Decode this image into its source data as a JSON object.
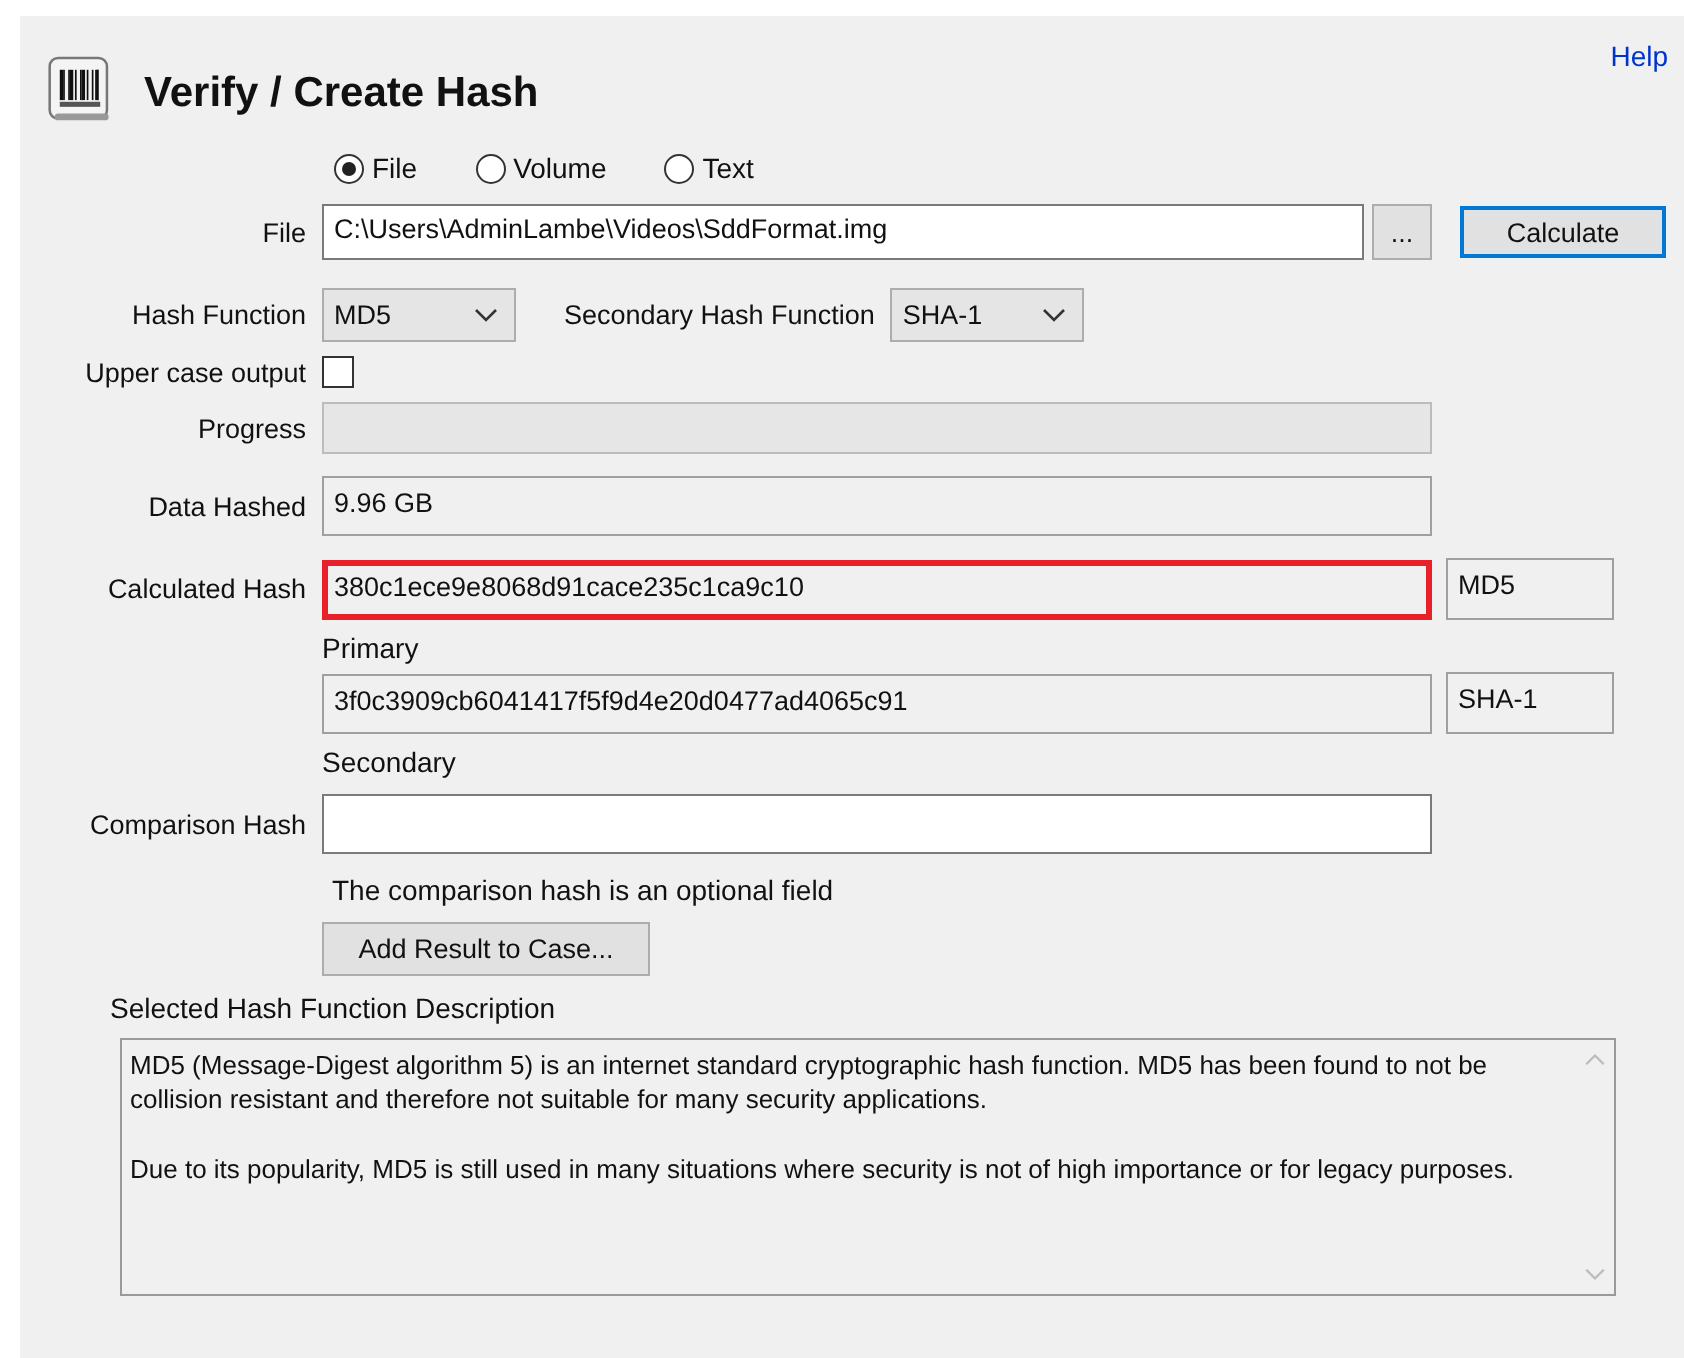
{
  "header": {
    "title": "Verify / Create Hash",
    "help_link": "Help"
  },
  "source_options": [
    {
      "label": "File",
      "selected": true
    },
    {
      "label": "Volume",
      "selected": false
    },
    {
      "label": "Text",
      "selected": false
    }
  ],
  "file": {
    "label": "File",
    "value": "C:\\Users\\AdminLambe\\Videos\\SddFormat.img",
    "browse_button": "...",
    "calculate_button": "Calculate"
  },
  "hash_function": {
    "label": "Hash Function",
    "value": "MD5"
  },
  "secondary_hash_function": {
    "label": "Secondary Hash Function",
    "value": "SHA-1"
  },
  "upper_case_output": {
    "label": "Upper case output",
    "checked": false
  },
  "progress": {
    "label": "Progress",
    "level": 0
  },
  "data_hashed": {
    "label": "Data Hashed",
    "value": "9.96 GB"
  },
  "calculated_hash": {
    "label": "Calculated Hash",
    "results": [
      {
        "value": "380c1ece9e8068d91cace235c1ca9c10",
        "algorithm": "MD5",
        "caption": "Primary",
        "highlighted": true
      },
      {
        "value": "3f0c3909cb6041417f5f9d4e20d0477ad4065c91",
        "algorithm": "SHA-1",
        "caption": "Secondary",
        "highlighted": false
      }
    ]
  },
  "comparison_hash": {
    "label": "Comparison Hash",
    "note": "The comparison hash is an optional field"
  },
  "add_result_button": "Add Result to Case...",
  "description": {
    "label": "Selected Hash Function Description",
    "paragraphs": [
      "MD5 (Message-Digest algorithm 5) is an internet standard cryptographic hash function. MD5 has been found to not be collision resistant and therefore not suitable for many security applications.",
      "Due to its popularity, MD5 is still used in many situations where security is not of high importance or for legacy purposes."
    ]
  }
}
